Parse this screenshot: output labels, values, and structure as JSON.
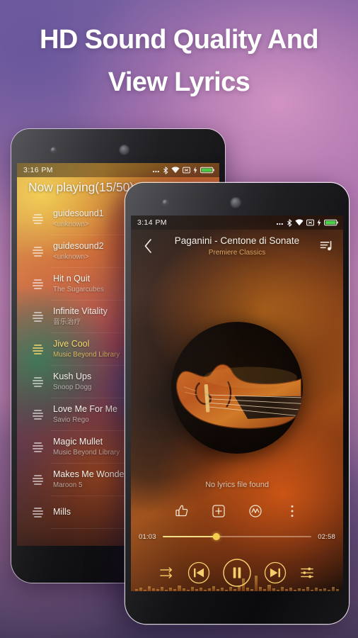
{
  "promo": {
    "headline_line1": "HD Sound Quality And",
    "headline_line2": "View Lyrics"
  },
  "left_phone": {
    "status_bar": {
      "time": "3:16 PM",
      "icons": [
        "more-dots-icon",
        "bluetooth-icon",
        "wifi-icon",
        "no-sim-icon",
        "charging-bolt-icon",
        "battery-icon"
      ]
    },
    "header_title": "Now playing(15/50)",
    "playlist": [
      {
        "title": "guidesound1",
        "artist": "<unknown>",
        "current": false
      },
      {
        "title": "guidesound2",
        "artist": "<unknown>",
        "current": false
      },
      {
        "title": "Hit n Quit",
        "artist": "The Sugarcubes",
        "current": false
      },
      {
        "title": "Infinite Vitality",
        "artist": "音乐治疗",
        "current": false
      },
      {
        "title": "Jive Cool",
        "artist": "Music Beyond Library",
        "current": true
      },
      {
        "title": "Kush Ups",
        "artist": "Snoop Dogg",
        "current": false
      },
      {
        "title": "Love Me For Me",
        "artist": "Savio Rego",
        "current": false
      },
      {
        "title": "Magic Mullet",
        "artist": "Music Beyond Library",
        "current": false
      },
      {
        "title": "Makes Me Wonder",
        "artist": "Maroon 5",
        "current": false
      },
      {
        "title": "Mills",
        "artist": "",
        "current": false
      }
    ]
  },
  "right_phone": {
    "status_bar": {
      "time": "3:14 PM",
      "icons": [
        "more-dots-icon",
        "bluetooth-icon",
        "wifi-icon",
        "no-sim-icon",
        "charging-bolt-icon",
        "battery-icon"
      ]
    },
    "now_playing": {
      "song_title": "Paganini - Centone di Sonate",
      "album": "Premiere Classics",
      "back_icon": "chevron-left-icon",
      "queue_icon": "playlist-queue-icon",
      "album_art": "violin-album-art"
    },
    "lyrics_status": "No lyrics file found",
    "actions": [
      {
        "name": "thumbs-up-icon"
      },
      {
        "name": "add-to-playlist-icon"
      },
      {
        "name": "sound-effect-icon"
      },
      {
        "name": "overflow-menu-icon"
      }
    ],
    "seek": {
      "elapsed": "01:03",
      "duration": "02:58",
      "progress_percent": 36
    },
    "transport": [
      {
        "name": "repeat-sequential-icon",
        "state": "sequential"
      },
      {
        "name": "previous-track-button"
      },
      {
        "name": "pause-button",
        "state": "playing"
      },
      {
        "name": "next-track-button"
      },
      {
        "name": "equalizer-button"
      }
    ]
  },
  "colors": {
    "accent_amber": "#f5ce4e",
    "accent_gold": "#f5d96b",
    "album_text": "#d9a15e",
    "battery_green": "#4cd34c",
    "text_primary": "#f6f3ec"
  }
}
